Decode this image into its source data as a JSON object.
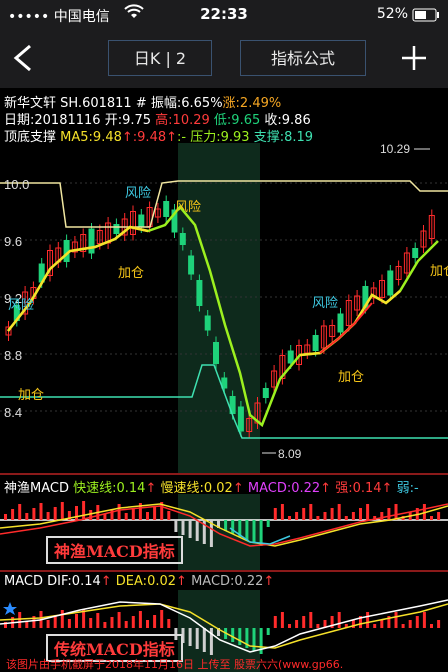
{
  "status": {
    "carrier": "••••• 中国电信",
    "time": "22:33",
    "battery": "52%"
  },
  "nav": {
    "back_glyph": "<",
    "period": "日K | 2",
    "formula": "指标公式",
    "add_glyph": "+"
  },
  "stock": {
    "name_code": "新华文轩 SH.601811",
    "amplitude": "# 振幅:6.65%",
    "change": "涨:2.49%",
    "date": "日期:20181116",
    "open": "开:9.75",
    "high": "高:10.29",
    "low": "低:9.65",
    "close": "收:9.86",
    "indicator_name": "顶底支撑",
    "ma5": "MA5:9.48",
    "ma_val2": ":9.48",
    "resistance": ":- 压力:9.93",
    "support": "支撑:8.19"
  },
  "main_chart": {
    "y_ticks": [
      "10.0",
      "9.6",
      "9.2",
      "8.8",
      "8.4"
    ],
    "max_label": "10.29",
    "min_label": "8.09",
    "annotations": {
      "risk1": "风险",
      "add1": "加仓",
      "risk2": "风险",
      "add2": "加仓",
      "add3": "加仓",
      "risk_top": "风险",
      "add_right": "加仓",
      "risk_left": "风险"
    }
  },
  "sub1": {
    "name": "神渔MACD",
    "fast": "快速线:0.14",
    "slow": "慢速线:0.02",
    "macd": "MACD:0.22",
    "strong": "强:0.14",
    "weak": "弱:-",
    "box_label": "神渔MACD指标"
  },
  "sub2": {
    "dif": "MACD DIF:0.14",
    "dea": "DEA:0.02",
    "macd": "MACD:0.22",
    "box_label": "传统MACD指标"
  },
  "watermark": "该图片由手机截屏于2018年11月16日 上传至 股票六六(www.gp66.",
  "colors": {
    "up": "#ff2b2b",
    "down": "#1fd27a",
    "ma_yellow": "#f5e12a",
    "ma_green": "#9cf01f",
    "resist": "#f0e6a0",
    "support": "#3ee0b0"
  }
}
